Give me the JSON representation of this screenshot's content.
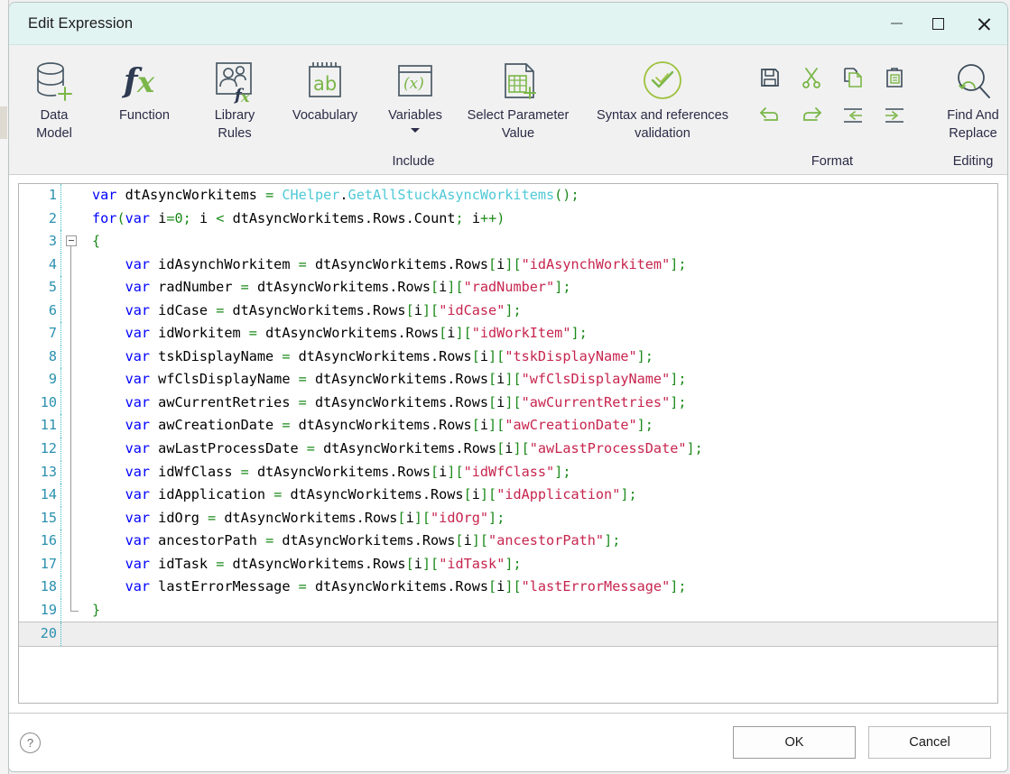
{
  "window": {
    "title": "Edit Expression",
    "controls": {
      "minimize": "–",
      "maximize": "□",
      "close": "×"
    }
  },
  "ribbon": {
    "groups": [
      {
        "caption": "",
        "items": [
          {
            "label_line1": "Data",
            "label_line2": "Model",
            "icon": "database-add-icon"
          },
          {
            "label_line1": "Function",
            "label_line2": "",
            "icon": "fx-icon"
          },
          {
            "label_line1": "Library",
            "label_line2": "Rules",
            "icon": "library-rules-icon"
          },
          {
            "label_line1": "Vocabulary",
            "label_line2": "",
            "icon": "vocabulary-notepad-icon"
          }
        ]
      },
      {
        "caption": "Include",
        "items": [
          {
            "label_line1": "Variables",
            "label_line2": "",
            "icon": "variables-icon",
            "has_dropdown": true
          },
          {
            "label_line1": "Select Parameter",
            "label_line2": "Value",
            "icon": "select-parameter-value-icon"
          },
          {
            "label_line1": "Syntax and references",
            "label_line2": "validation",
            "icon": "syntax-validation-icon"
          }
        ]
      },
      {
        "caption": "Format",
        "tools": [
          {
            "name": "save-icon",
            "title": "Save"
          },
          {
            "name": "cut-icon",
            "title": "Cut"
          },
          {
            "name": "copy-icon",
            "title": "Copy"
          },
          {
            "name": "paste-icon",
            "title": "Paste"
          },
          {
            "name": "undo-icon",
            "title": "Undo"
          },
          {
            "name": "redo-icon",
            "title": "Redo"
          },
          {
            "name": "outdent-icon",
            "title": "Outdent"
          },
          {
            "name": "indent-icon",
            "title": "Indent"
          }
        ]
      },
      {
        "caption": "Editing",
        "items": [
          {
            "label_line1": "Find And",
            "label_line2": "Replace",
            "icon": "find-and-replace-icon"
          }
        ]
      }
    ]
  },
  "editor": {
    "language": "csharp-script",
    "current_line": 20,
    "total_lines": 20,
    "fold_start_line": 3,
    "fold_end_line": 19,
    "colors": {
      "keyword": "#0000ff",
      "type": "#4ec9d6",
      "string": "#c7254e",
      "bracket": "#1a8a1a",
      "plain": "#000000",
      "line_number": "#2b91af"
    },
    "lines": [
      {
        "n": 1,
        "text": "var dtAsyncWorkitems = CHelper.GetAllStuckAsyncWorkitems();"
      },
      {
        "n": 2,
        "text": "for(var i=0; i < dtAsyncWorkitems.Rows.Count; i++)"
      },
      {
        "n": 3,
        "text": "{"
      },
      {
        "n": 4,
        "text": "    var idAsynchWorkitem = dtAsyncWorkitems.Rows[i][\"idAsynchWorkitem\"];"
      },
      {
        "n": 5,
        "text": "    var radNumber = dtAsyncWorkitems.Rows[i][\"radNumber\"];"
      },
      {
        "n": 6,
        "text": "    var idCase = dtAsyncWorkitems.Rows[i][\"idCase\"];"
      },
      {
        "n": 7,
        "text": "    var idWorkitem = dtAsyncWorkitems.Rows[i][\"idWorkItem\"];"
      },
      {
        "n": 8,
        "text": "    var tskDisplayName = dtAsyncWorkitems.Rows[i][\"tskDisplayName\"];"
      },
      {
        "n": 9,
        "text": "    var wfClsDisplayName = dtAsyncWorkitems.Rows[i][\"wfClsDisplayName\"];"
      },
      {
        "n": 10,
        "text": "    var awCurrentRetries = dtAsyncWorkitems.Rows[i][\"awCurrentRetries\"];"
      },
      {
        "n": 11,
        "text": "    var awCreationDate = dtAsyncWorkitems.Rows[i][\"awCreationDate\"];"
      },
      {
        "n": 12,
        "text": "    var awLastProcessDate = dtAsyncWorkitems.Rows[i][\"awLastProcessDate\"];"
      },
      {
        "n": 13,
        "text": "    var idWfClass = dtAsyncWorkitems.Rows[i][\"idWfClass\"];"
      },
      {
        "n": 14,
        "text": "    var idApplication = dtAsyncWorkitems.Rows[i][\"idApplication\"];"
      },
      {
        "n": 15,
        "text": "    var idOrg = dtAsyncWorkitems.Rows[i][\"idOrg\"];"
      },
      {
        "n": 16,
        "text": "    var ancestorPath = dtAsyncWorkitems.Rows[i][\"ancestorPath\"];"
      },
      {
        "n": 17,
        "text": "    var idTask = dtAsyncWorkitems.Rows[i][\"idTask\"];"
      },
      {
        "n": 18,
        "text": "    var lastErrorMessage = dtAsyncWorkitems.Rows[i][\"lastErrorMessage\"];"
      },
      {
        "n": 19,
        "text": "}"
      },
      {
        "n": 20,
        "text": ""
      }
    ]
  },
  "footer": {
    "help_label": "?",
    "ok_label": "OK",
    "cancel_label": "Cancel"
  }
}
